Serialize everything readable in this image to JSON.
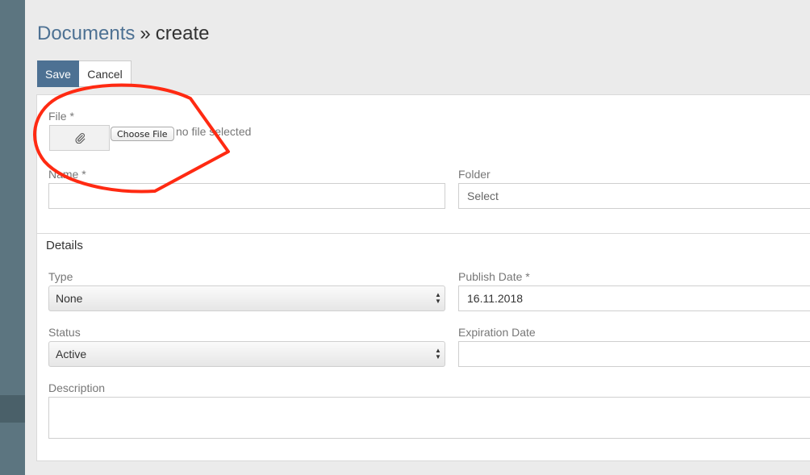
{
  "breadcrumb": {
    "parent": "Documents",
    "separator": "»",
    "current": "create"
  },
  "toolbar": {
    "save_label": "Save",
    "cancel_label": "Cancel"
  },
  "form": {
    "file": {
      "label": "File *",
      "choose_label": "Choose File",
      "status": "no file selected",
      "icon": "paperclip-icon"
    },
    "name": {
      "label": "Name *",
      "value": ""
    },
    "folder": {
      "label": "Folder",
      "placeholder": "Select"
    },
    "details_title": "Details",
    "type": {
      "label": "Type",
      "value": "None"
    },
    "publish_date": {
      "label": "Publish Date *",
      "value": "16.11.2018"
    },
    "status": {
      "label": "Status",
      "value": "Active"
    },
    "expiration_date": {
      "label": "Expiration Date",
      "value": ""
    },
    "description": {
      "label": "Description",
      "value": ""
    }
  },
  "colors": {
    "sidebar": "#5c7580",
    "accent": "#4d7193",
    "annotation": "#ff2a12"
  }
}
